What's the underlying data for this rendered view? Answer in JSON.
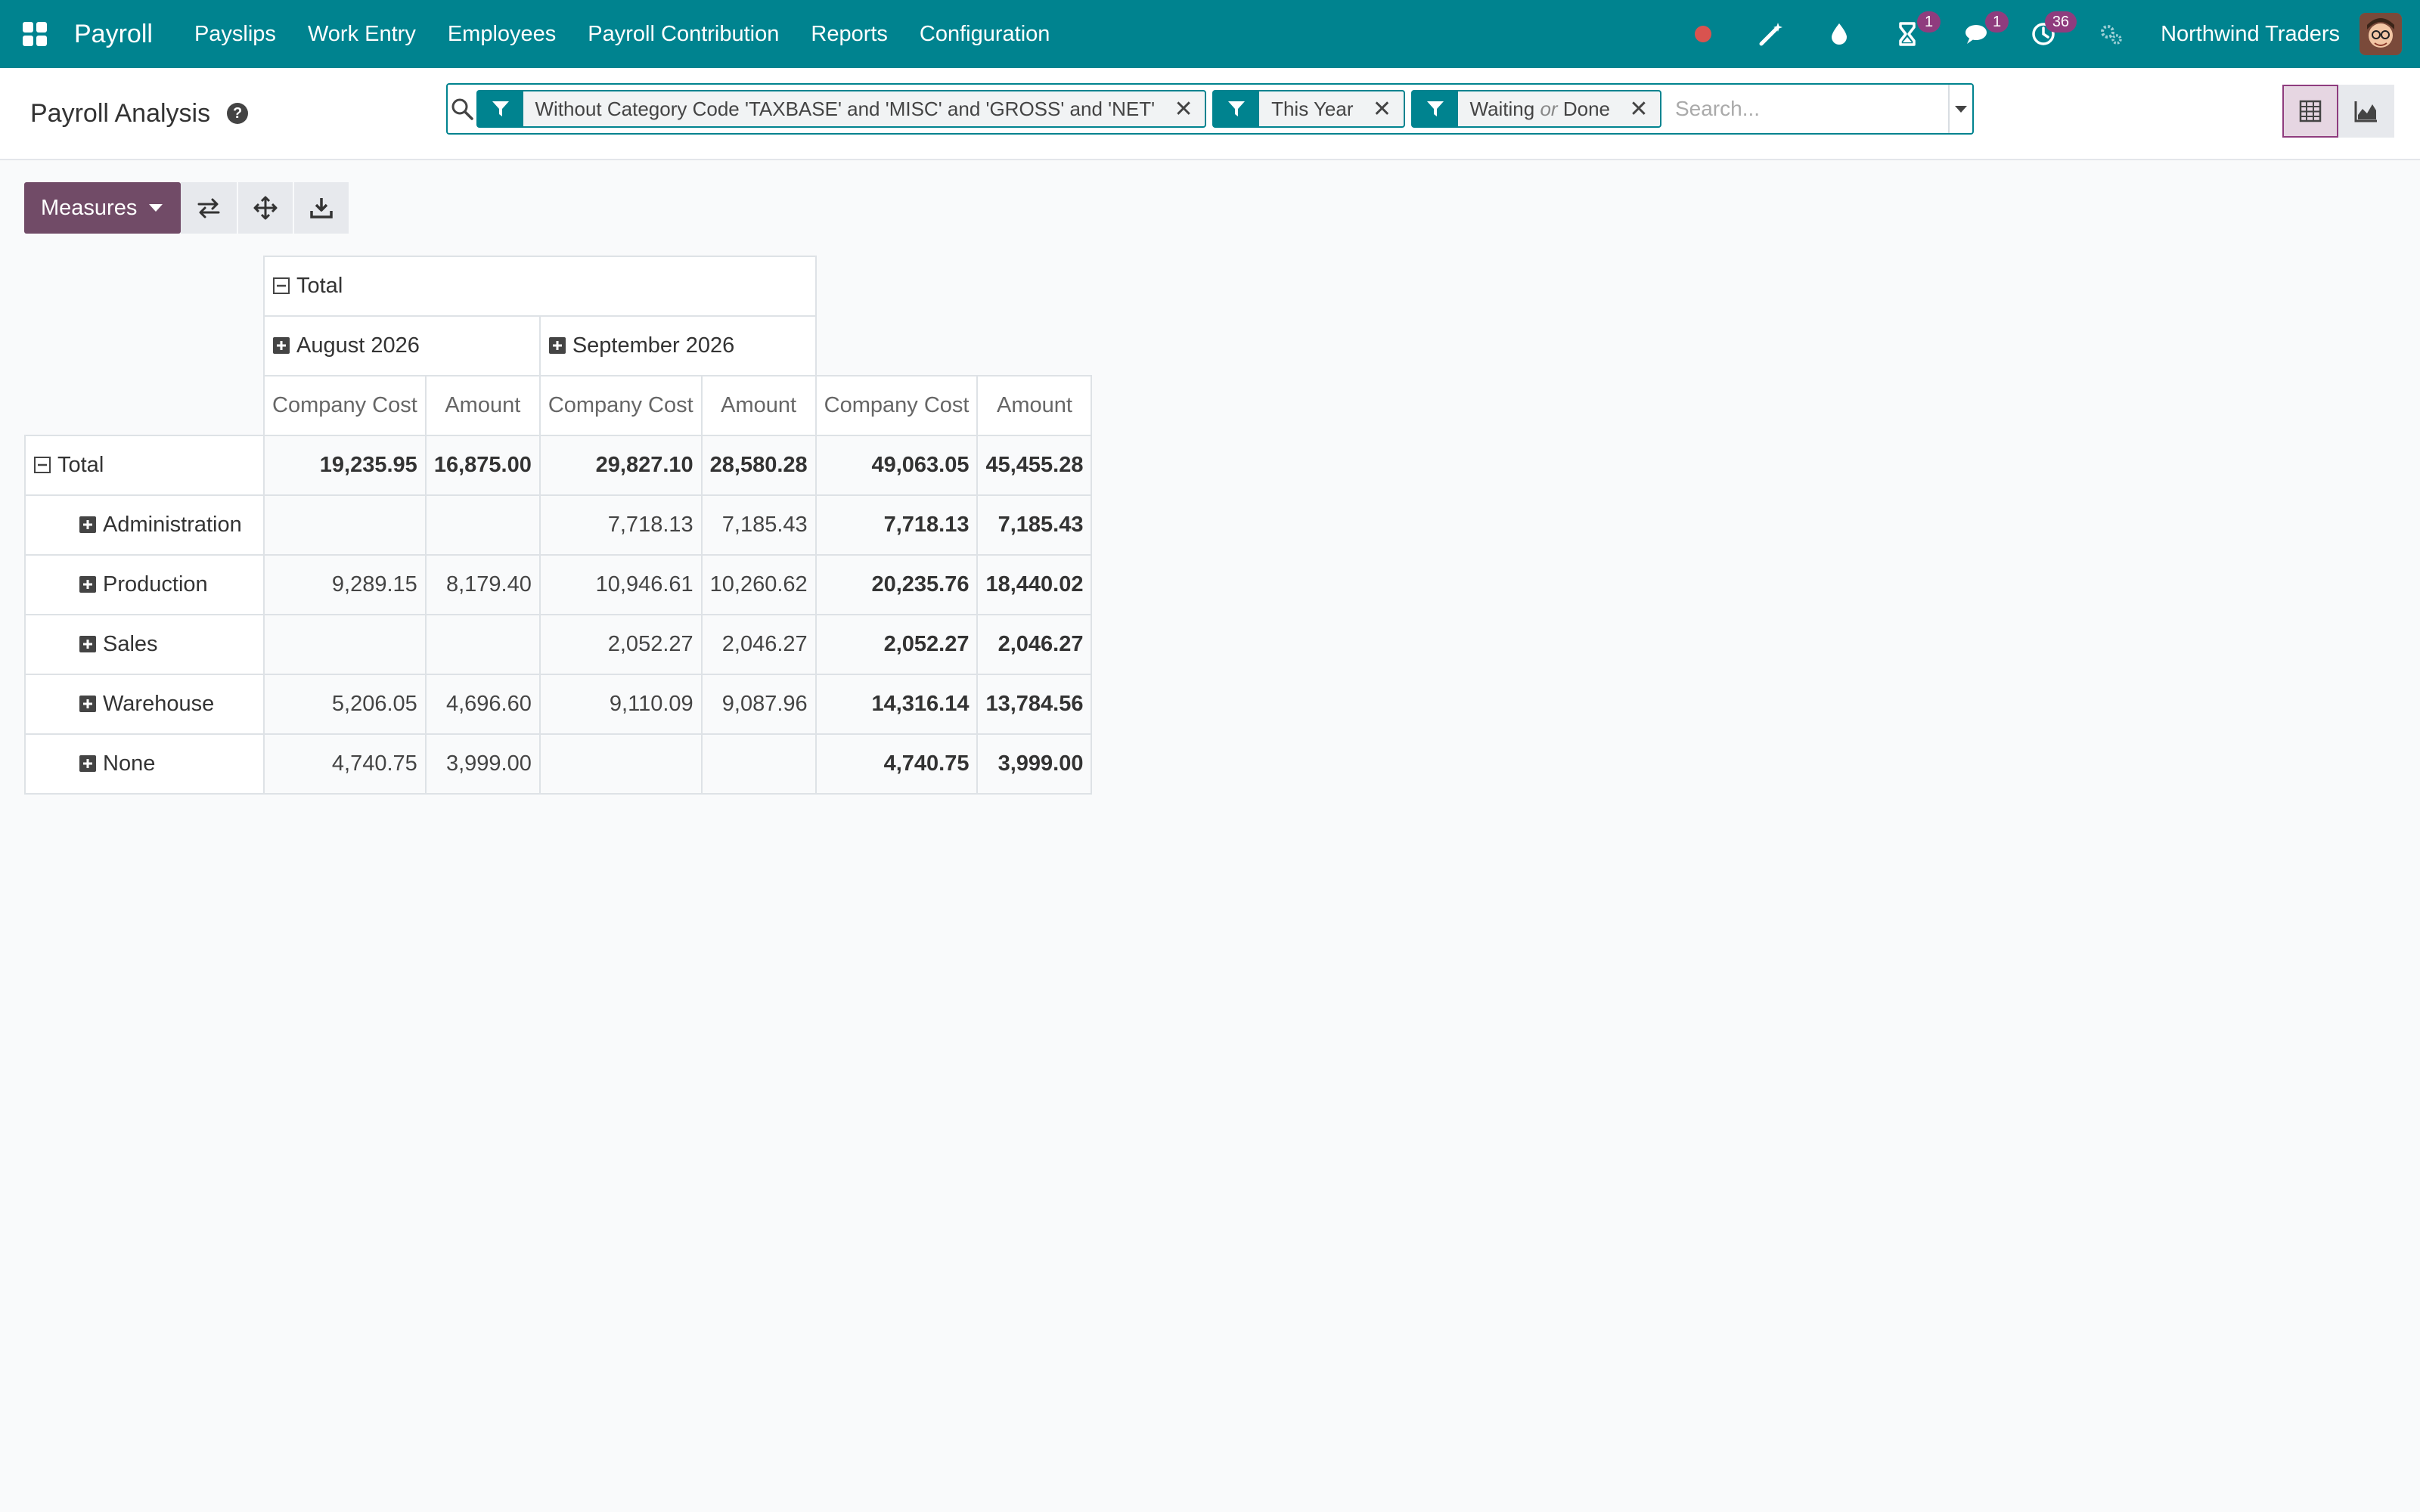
{
  "navbar": {
    "app_name": "Payroll",
    "menu": [
      "Payslips",
      "Work Entry",
      "Employees",
      "Payroll Contribution",
      "Reports",
      "Configuration"
    ],
    "badges": {
      "activity": "1",
      "messages": "1",
      "clock": "36"
    },
    "company": "Northwind Traders",
    "colors": {
      "bar": "#00838f",
      "badge": "#8f3c7e",
      "record": "#d9534f"
    }
  },
  "control_panel": {
    "title": "Payroll Analysis",
    "facets": [
      {
        "text": "Without Category Code 'TAXBASE' and 'MISC' and 'GROSS' and 'NET'"
      },
      {
        "text": "This Year"
      },
      {
        "text_a": "Waiting",
        "connector": "or",
        "text_b": "Done"
      }
    ],
    "search_placeholder": "Search..."
  },
  "toolbar": {
    "measures_label": "Measures"
  },
  "pivot": {
    "col_total_label": "Total",
    "months": [
      "August 2026",
      "September 2026"
    ],
    "measures": [
      "Company Cost",
      "Amount",
      "Company Cost",
      "Amount",
      "Company Cost",
      "Amount"
    ],
    "rows": [
      {
        "label": "Total",
        "values": [
          "19,235.95",
          "16,875.00",
          "29,827.10",
          "28,580.28",
          "49,063.05",
          "45,455.28"
        ]
      },
      {
        "label": "Administration",
        "values": [
          "",
          "",
          "7,718.13",
          "7,185.43",
          "7,718.13",
          "7,185.43"
        ]
      },
      {
        "label": "Production",
        "values": [
          "9,289.15",
          "8,179.40",
          "10,946.61",
          "10,260.62",
          "20,235.76",
          "18,440.02"
        ]
      },
      {
        "label": "Sales",
        "values": [
          "",
          "",
          "2,052.27",
          "2,046.27",
          "2,052.27",
          "2,046.27"
        ]
      },
      {
        "label": "Warehouse",
        "values": [
          "5,206.05",
          "4,696.60",
          "9,110.09",
          "9,087.96",
          "14,316.14",
          "13,784.56"
        ]
      },
      {
        "label": "None",
        "values": [
          "4,740.75",
          "3,999.00",
          "",
          "",
          "4,740.75",
          "3,999.00"
        ]
      }
    ]
  }
}
